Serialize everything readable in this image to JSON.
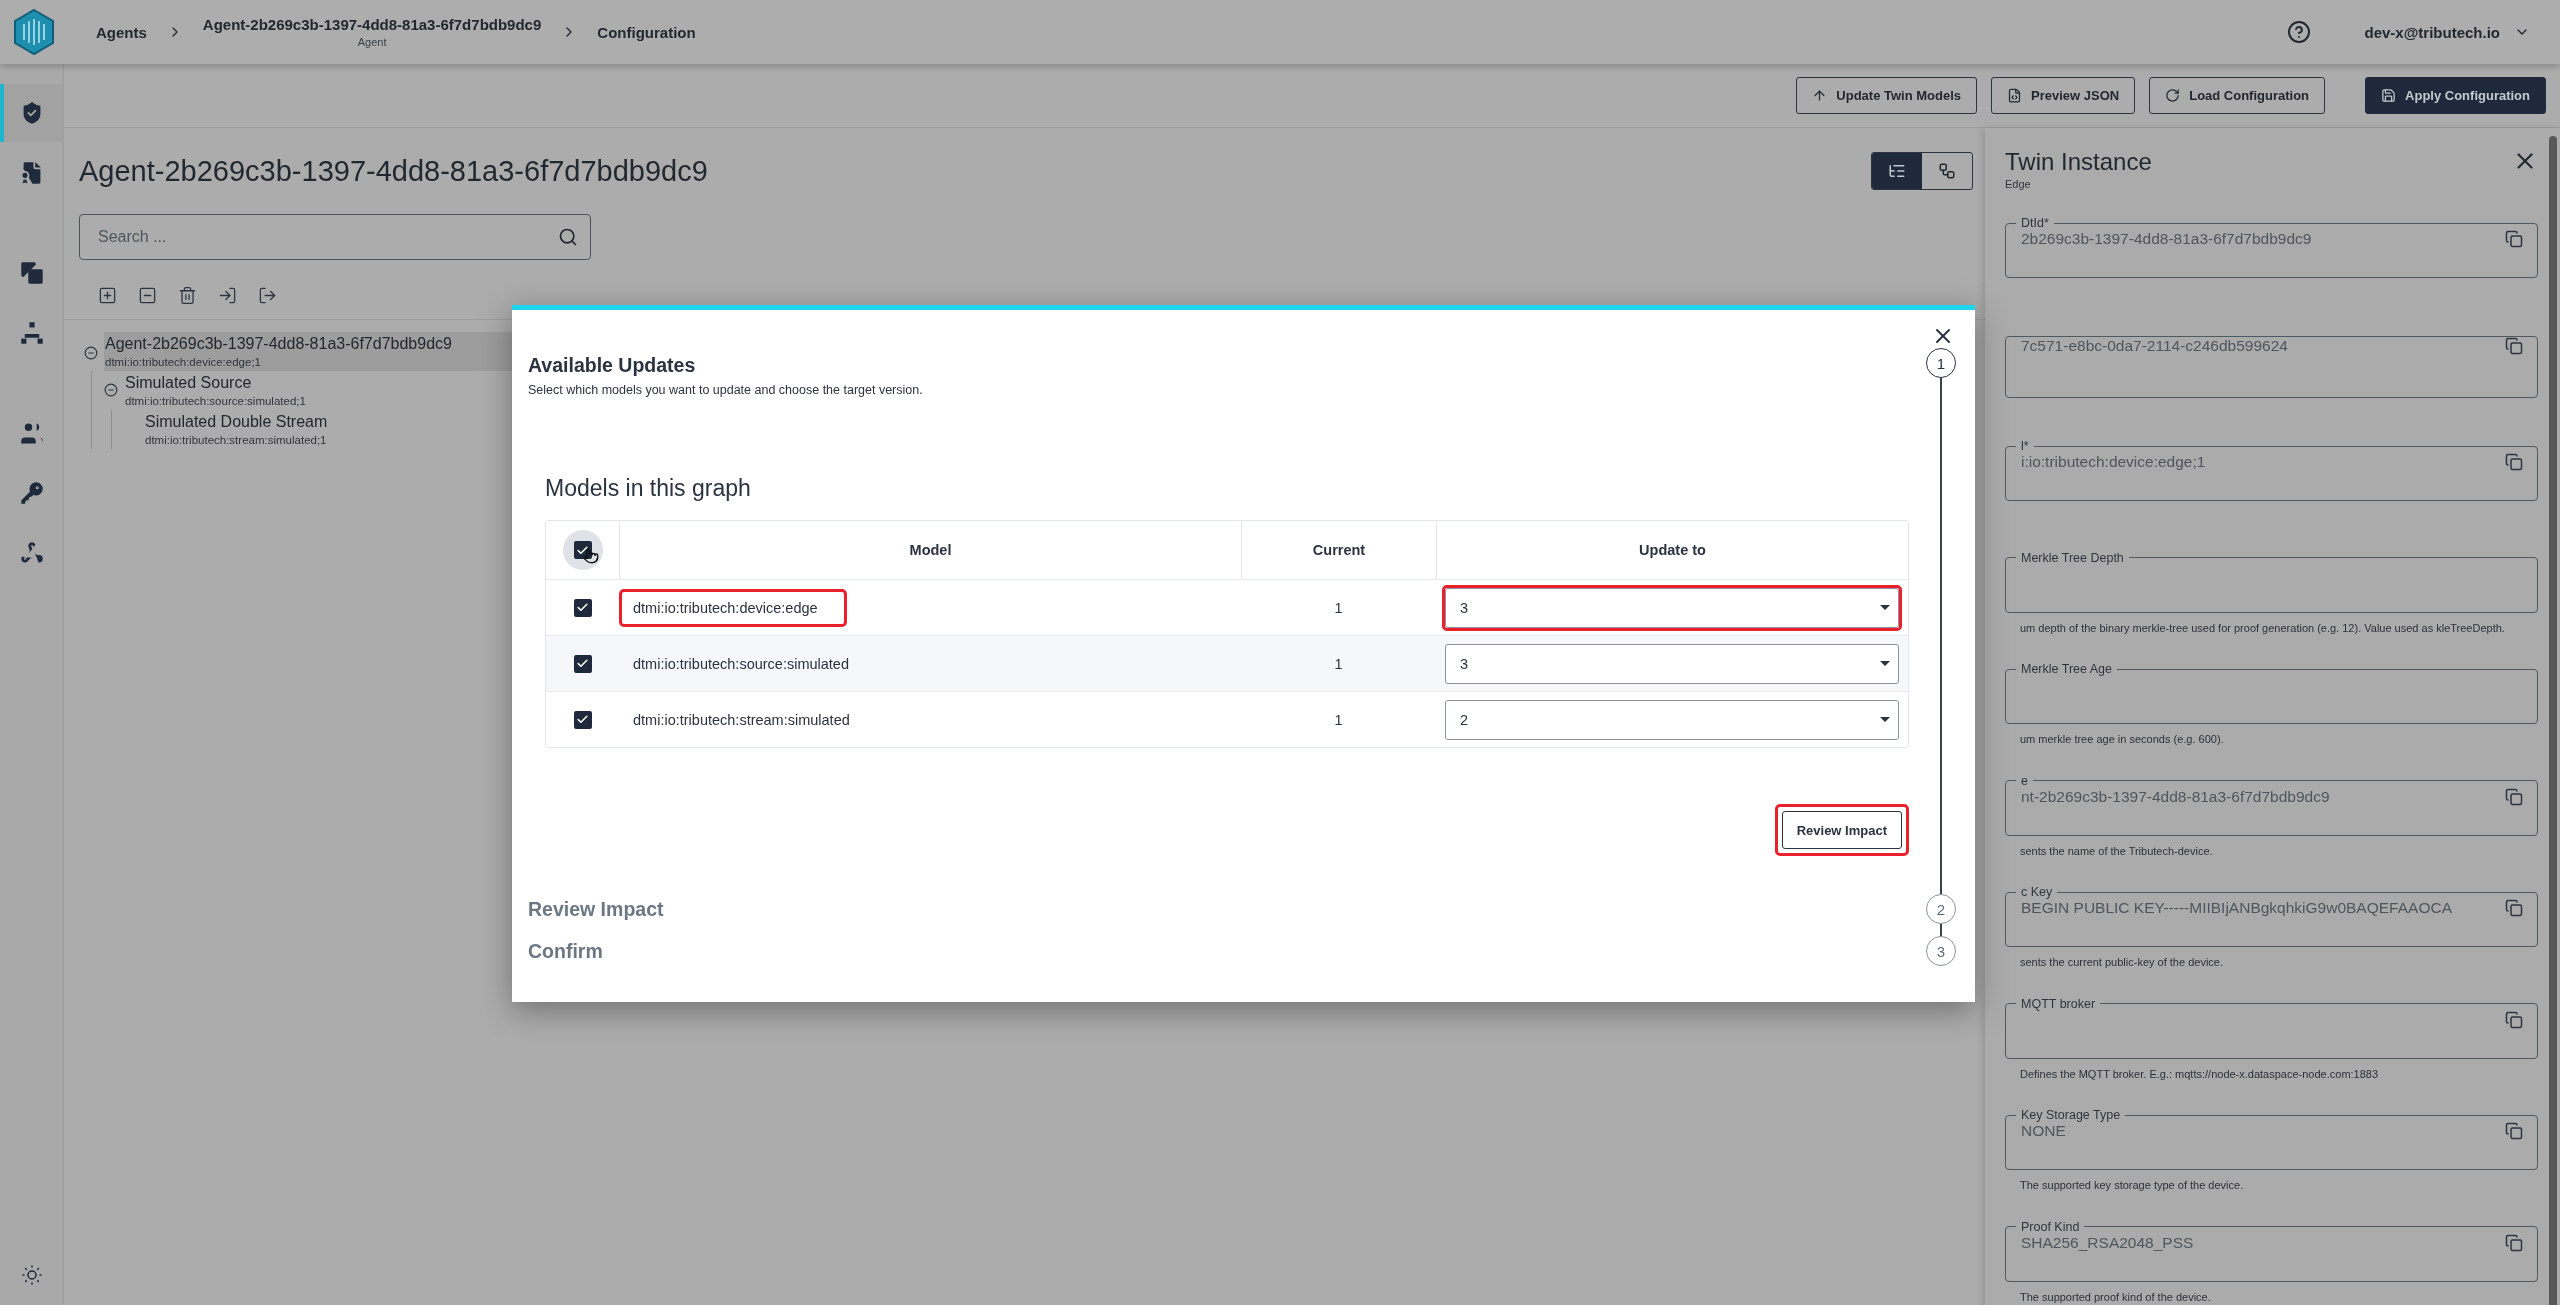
{
  "header": {
    "breadcrumbs": [
      {
        "label": "Agents"
      },
      {
        "label": "Agent-2b269c3b-1397-4dd8-81a3-6f7d7bdb9dc9",
        "sublabel": "Agent"
      },
      {
        "label": "Configuration"
      }
    ],
    "user": "dev-x@tributech.io"
  },
  "sidebar": {
    "items": [
      {
        "selected": true
      },
      {
        "selected": false
      },
      {
        "selected": false
      },
      {
        "selected": false
      },
      {
        "selected": false
      },
      {
        "selected": false
      },
      {
        "selected": false
      }
    ]
  },
  "toolbar": {
    "buttons": [
      {
        "label": "Update Twin Models",
        "kind": "outline"
      },
      {
        "label": "Preview JSON",
        "kind": "outline"
      },
      {
        "label": "Load Configuration",
        "kind": "outline"
      },
      {
        "label": "Apply Configuration",
        "kind": "primary"
      }
    ]
  },
  "content": {
    "title": "Agent-2b269c3b-1397-4dd8-81a3-6f7d7bdb9dc9",
    "search": {
      "placeholder": "Search ..."
    },
    "view_toggle": [
      {
        "selected": true
      },
      {
        "selected": false
      }
    ],
    "tree": [
      {
        "name": "Agent-2b269c3b-1397-4dd8-81a3-6f7d7bdb9dc9",
        "model": "dtmi:io:tributech:device:edge;1",
        "selected": true,
        "expanded": true,
        "children": [
          {
            "name": "Simulated Source",
            "model": "dtmi:io:tributech:source:simulated;1",
            "selected": false,
            "expanded": true,
            "children": [
              {
                "name": "Simulated Double Stream",
                "model": "dtmi:io:tributech:stream:simulated;1",
                "selected": false,
                "expanded": false
              }
            ]
          }
        ]
      }
    ]
  },
  "panel": {
    "title": "Twin Instance",
    "subtitle": "Edge",
    "fields": [
      {
        "label": "DtId*",
        "value": "2b269c3b-1397-4dd8-81a3-6f7d7bdb9dc9",
        "copyable": true
      },
      {
        "value": "7c571-e8bc-0da7-2114-c246db599624",
        "copyable": true
      },
      {
        "label": "l*",
        "value": "i:io:tributech:device:edge;1",
        "copyable": true
      },
      {
        "label": "Merkle Tree Depth",
        "helper": "um depth of the binary merkle-tree used for proof generation (e.g. 12). Value used as kleTreeDepth.",
        "copyable": false
      },
      {
        "label": "Merkle Tree Age",
        "helper": "um merkle tree age in seconds (e.g. 600).",
        "copyable": false
      },
      {
        "label": "e",
        "value": "nt-2b269c3b-1397-4dd8-81a3-6f7d7bdb9dc9",
        "helper": "sents the name of the Tributech-device.",
        "copyable": true
      },
      {
        "label": "c Key",
        "value": "BEGIN PUBLIC KEY-----MIIBIjANBgkqhkiG9w0BAQEFAAOCA",
        "helper": "sents the current public-key of the device.",
        "copyable": true
      },
      {
        "label": "MQTT broker",
        "helper": "Defines the MQTT broker. E.g.: mqtts://node-x.dataspace-node.com:1883",
        "copyable": true
      },
      {
        "label": "Key Storage Type",
        "value": "NONE",
        "helper": "The supported key storage type of the device.",
        "copyable": true
      },
      {
        "label": "Proof Kind",
        "value": "SHA256_RSA2048_PSS",
        "helper": "The supported proof kind of the device.",
        "copyable": true
      }
    ]
  },
  "dialog": {
    "steps": [
      {
        "number": "1",
        "title": "Available Updates",
        "subtitle": "Select which models you want to update and choose the target version.",
        "active": true
      },
      {
        "number": "2",
        "title": "Review Impact",
        "active": false
      },
      {
        "number": "3",
        "title": "Confirm",
        "active": false
      }
    ],
    "section_title": "Models in this graph",
    "table": {
      "all_checked": true,
      "columns": [
        "Model",
        "Current",
        "Update to"
      ],
      "rows": [
        {
          "checked": true,
          "model": "dtmi:io:tributech:device:edge",
          "current": "1",
          "update_to": "3",
          "highlighted": true
        },
        {
          "checked": true,
          "model": "dtmi:io:tributech:source:simulated",
          "current": "1",
          "update_to": "3",
          "highlighted": false
        },
        {
          "checked": true,
          "model": "dtmi:io:tributech:stream:simulated",
          "current": "1",
          "update_to": "2",
          "highlighted": false
        }
      ]
    },
    "next_button": {
      "label": "Review Impact",
      "highlighted": true
    }
  }
}
